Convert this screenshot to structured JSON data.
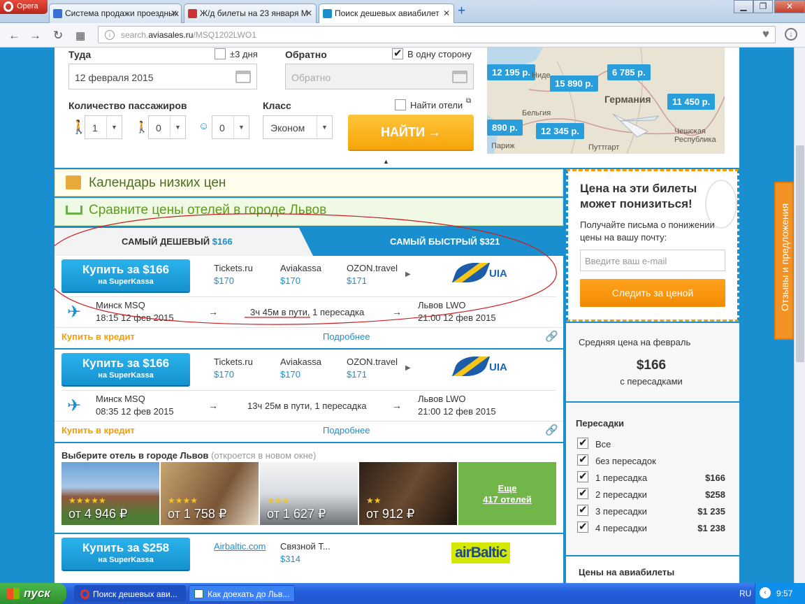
{
  "browser": {
    "opera_label": "Opera",
    "tabs": [
      {
        "title": "Система продажи проездных",
        "active": false
      },
      {
        "title": "Ж/д билеты на 23 января М",
        "active": false
      },
      {
        "title": "Поиск дешевых авиабилет",
        "active": true
      }
    ],
    "url_domain": "search.",
    "url_host": "aviasales.ru",
    "url_path": "/MSQ1202LWO1"
  },
  "search_form": {
    "from_label": "Туда",
    "flex_label": "±3 дня",
    "return_label": "Обратно",
    "oneway_label": "В одну сторону",
    "date_value": "12 февраля 2015",
    "return_placeholder": "Обратно",
    "passengers_label": "Количество пассажиров",
    "adults": "1",
    "children": "0",
    "infants": "0",
    "class_label": "Класс",
    "class_value": "Эконом",
    "hotels_label": "Найти отели",
    "find_button": "НАЙТИ →"
  },
  "map": {
    "prices": [
      "12 195 р.",
      "6 785 р.",
      "15 890 р.",
      "11 450 р.",
      "890 р.",
      "12 345 р."
    ],
    "cities": [
      "Нидe",
      "Германия",
      "Бельгия",
      "Чешская Республика",
      "Париж",
      "Путтгарт"
    ]
  },
  "banners": {
    "calendar": "Календарь низких цен",
    "hotels_compare": "Сравните цены отелей в городе Львов"
  },
  "sort_tabs": {
    "cheapest_label": "САМЫЙ ДЕШЕВЫЙ",
    "cheapest_price": "$166",
    "fastest": "САМЫЙ БЫСТРЫЙ $321"
  },
  "tickets": [
    {
      "buy_price": "Купить за $166",
      "buy_via": "на SuperKassa",
      "agencies": [
        {
          "name": "Tickets.ru",
          "price": "$170"
        },
        {
          "name": "Aviakassa",
          "price": "$170"
        },
        {
          "name": "OZON.travel",
          "price": "$171"
        }
      ],
      "airline": "UIA",
      "from_city": "Минск MSQ",
      "from_time": "18:15 12 фев 2015",
      "duration_underlined": "3ч 45м в пути",
      "duration_rest": ", 1 пересадка",
      "to_city": "Львов LWO",
      "to_time": "21:00 12 фев 2015",
      "credit": "Купить в кредит",
      "details": "Подробнее"
    },
    {
      "buy_price": "Купить за $166",
      "buy_via": "на SuperKassa",
      "agencies": [
        {
          "name": "Tickets.ru",
          "price": "$170"
        },
        {
          "name": "Aviakassa",
          "price": "$170"
        },
        {
          "name": "OZON.travel",
          "price": "$171"
        }
      ],
      "airline": "UIA",
      "from_city": "Минск MSQ",
      "from_time": "08:35 12 фев 2015",
      "duration": "13ч 25м в пути, 1 пересадка",
      "to_city": "Львов LWO",
      "to_time": "21:00 12 фев 2015",
      "credit": "Купить в кредит",
      "details": "Подробнее"
    },
    {
      "buy_price": "Купить за $258",
      "buy_via": "на SuperKassa",
      "agencies": [
        {
          "name": "Airbaltic.com",
          "price": ""
        },
        {
          "name": "Связной Т...",
          "price": "$314"
        }
      ],
      "airline": "airBaltic"
    }
  ],
  "hotels": {
    "title": "Выберите отель в городе Львов",
    "note": "(откроется в новом окне)",
    "items": [
      {
        "stars": "★★★★★",
        "price": "от 4 946 ₽"
      },
      {
        "stars": "★★★★",
        "price": "от 1 758 ₽"
      },
      {
        "stars": "★★★",
        "price": "от 1 627 ₽"
      },
      {
        "stars": "★★",
        "price": "от 912 ₽"
      }
    ],
    "more_line1": "Еще",
    "more_line2": "417 отелей"
  },
  "sidebar": {
    "alert_title": "Цена на эти билеты может понизиться!",
    "alert_text": "Получайте письма о понижении цены на вашу почту:",
    "email_placeholder": "Введите ваш e-mail",
    "track_button": "Следить за ценой",
    "avg_label": "Средняя цена на февраль",
    "avg_price": "$166",
    "avg_note": "с пересадками",
    "stops_title": "Пересадки",
    "stops": [
      {
        "label": "Все",
        "price": ""
      },
      {
        "label": "без пересадок",
        "price": ""
      },
      {
        "label": "1 пересадка",
        "price": "$166"
      },
      {
        "label": "2 пересадки",
        "price": "$258"
      },
      {
        "label": "3 пересадки",
        "price": "$1 235"
      },
      {
        "label": "4 пересадки",
        "price": "$1 238"
      }
    ],
    "prices_title": "Цены на авиабилеты"
  },
  "feedback_tab": "Отзывы и предложения",
  "taskbar": {
    "start": "пуск",
    "tasks": [
      "Поиск дешевых ави...",
      "Как доехать до Льв..."
    ],
    "lang": "RU",
    "clock": "9:57"
  },
  "colors": {
    "accent": "#1a8fd0",
    "orange": "#f39d0b",
    "annotation": "#cc1e1e"
  }
}
